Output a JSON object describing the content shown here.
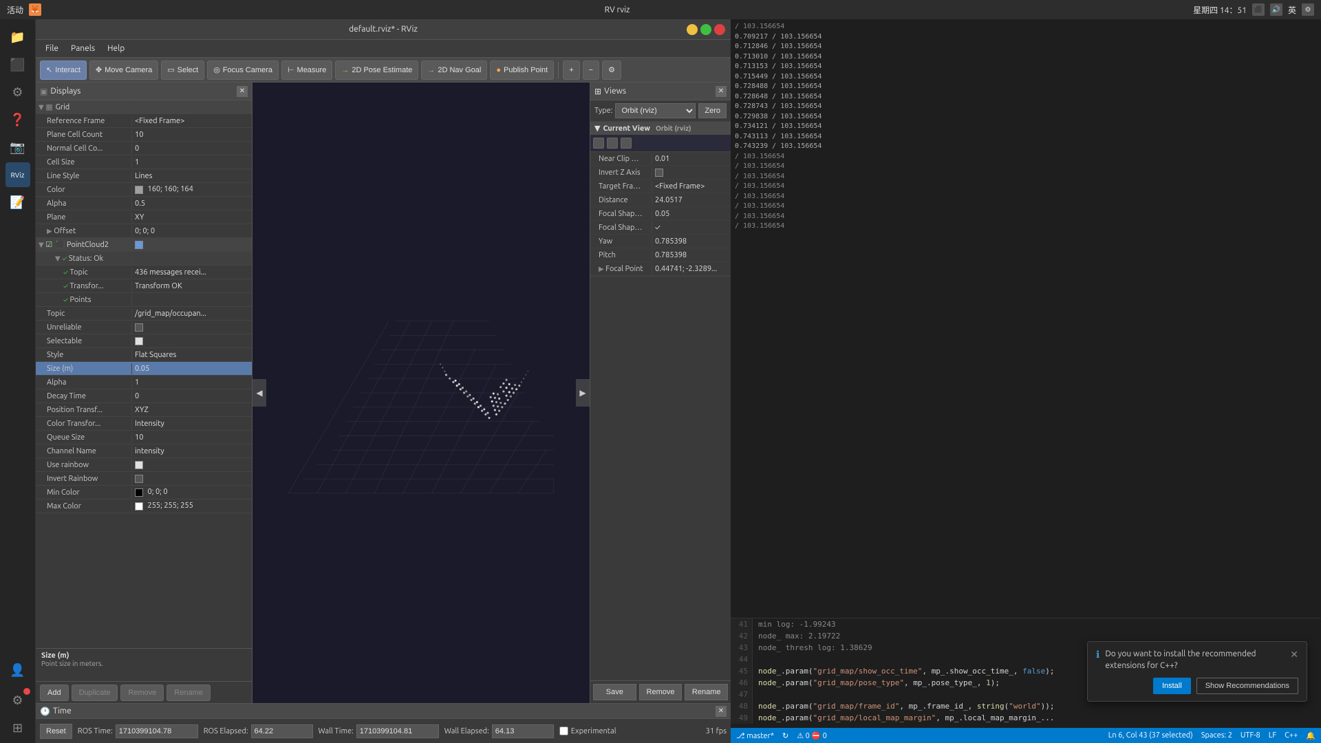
{
  "system_bar": {
    "app_name": "活动",
    "window_title": "RV rviz",
    "time": "星期四 14：51",
    "lang": "英"
  },
  "window": {
    "title": "default.rviz* - RViz"
  },
  "menu": {
    "file": "File",
    "panels": "Panels",
    "help": "Help"
  },
  "toolbar": {
    "interact": "Interact",
    "move_camera": "Move Camera",
    "select": "Select",
    "focus_camera": "Focus Camera",
    "measure": "Measure",
    "pose_estimate": "2D Pose Estimate",
    "nav_goal": "2D Nav Goal",
    "publish_point": "Publish Point"
  },
  "displays_panel": {
    "title": "Displays",
    "properties": [
      {
        "name": "Reference Frame",
        "value": "<Fixed Frame>",
        "indent": 1
      },
      {
        "name": "Plane Cell Count",
        "value": "10",
        "indent": 1
      },
      {
        "name": "Normal Cell Co...",
        "value": "0",
        "indent": 1
      },
      {
        "name": "Cell Size",
        "value": "1",
        "indent": 1
      },
      {
        "name": "Line Style",
        "value": "Lines",
        "indent": 1
      },
      {
        "name": "Color",
        "value": "160; 160; 164",
        "indent": 1,
        "has_swatch": true,
        "swatch_color": "#a0a0a4"
      },
      {
        "name": "Alpha",
        "value": "0.5",
        "indent": 1
      },
      {
        "name": "Plane",
        "value": "XY",
        "indent": 1
      },
      {
        "name": "Offset",
        "value": "0; 0; 0",
        "indent": 1,
        "has_arrow": true
      },
      {
        "name": "PointCloud2",
        "value": "",
        "indent": 0,
        "is_section": true,
        "checked": true
      },
      {
        "name": "Status: Ok",
        "value": "",
        "indent": 2,
        "has_check": true
      },
      {
        "name": "Topic",
        "value": "436 messages recei...",
        "indent": 3
      },
      {
        "name": "Transfor...",
        "value": "Transform OK",
        "indent": 3
      },
      {
        "name": "Points",
        "value": "",
        "indent": 3
      },
      {
        "name": "Topic",
        "value": "/grid_map/occupan...",
        "indent": 1
      },
      {
        "name": "Unreliable",
        "value": "",
        "indent": 1,
        "has_checkbox": true,
        "checked": false
      },
      {
        "name": "Selectable",
        "value": "",
        "indent": 1,
        "has_checkbox": true,
        "checked": true
      },
      {
        "name": "Style",
        "value": "Flat Squares",
        "indent": 1
      },
      {
        "name": "Size (m)",
        "value": "0.05",
        "indent": 1,
        "highlighted": true
      },
      {
        "name": "Alpha",
        "value": "1",
        "indent": 1
      },
      {
        "name": "Decay Time",
        "value": "0",
        "indent": 1
      },
      {
        "name": "Position Transf...",
        "value": "XYZ",
        "indent": 1
      },
      {
        "name": "Color Transfor...",
        "value": "Intensity",
        "indent": 1
      },
      {
        "name": "Queue Size",
        "value": "10",
        "indent": 1
      },
      {
        "name": "Channel Name",
        "value": "intensity",
        "indent": 1
      },
      {
        "name": "Use rainbow",
        "value": "",
        "indent": 1,
        "has_checkbox": true,
        "checked": true
      },
      {
        "name": "Invert Rainbow",
        "value": "",
        "indent": 1,
        "has_checkbox": true,
        "checked": false
      },
      {
        "name": "Min Color",
        "value": "0; 0; 0",
        "indent": 1,
        "has_swatch": true,
        "swatch_color": "#000000"
      },
      {
        "name": "Max Color",
        "value": "255; 255; 255",
        "indent": 1,
        "has_swatch": true,
        "swatch_color": "#ffffff"
      }
    ],
    "tooltip_title": "Size (m)",
    "tooltip_desc": "Point size in meters.",
    "buttons": [
      "Add",
      "Duplicate",
      "Remove",
      "Rename"
    ]
  },
  "views_panel": {
    "title": "Views",
    "type_label": "Type:",
    "type_value": "Orbit (rviz)",
    "zero_btn": "Zero",
    "current_view": {
      "title": "Current View",
      "type": "Orbit (rviz)",
      "properties": [
        {
          "name": "Near Clip …",
          "value": "0.01"
        },
        {
          "name": "Invert Z Axis",
          "value": "checkbox_empty"
        },
        {
          "name": "Target Fra…",
          "value": "<Fixed Frame>"
        },
        {
          "name": "Distance",
          "value": "24.0517"
        },
        {
          "name": "Focal Shap…",
          "value": "0.05"
        },
        {
          "name": "Focal Shap…",
          "value": "✓"
        },
        {
          "name": "Yaw",
          "value": "0.785398"
        },
        {
          "name": "Pitch",
          "value": "0.785398"
        },
        {
          "name": "Focal Point",
          "value": "0.44741; -2.3289...",
          "has_arrow": true
        }
      ]
    },
    "buttons": [
      "Save",
      "Remove",
      "Rename"
    ]
  },
  "time_panel": {
    "title": "Time",
    "ros_time_label": "ROS Time:",
    "ros_time_value": "1710399104.78",
    "ros_elapsed_label": "ROS Elapsed:",
    "ros_elapsed_value": "64.22",
    "wall_time_label": "Wall Time:",
    "wall_time_value": "1710399104.81",
    "wall_elapsed_label": "Wall Elapsed:",
    "wall_elapsed_value": "64.13",
    "experimental_label": "Experimental",
    "fps": "31 fps",
    "reset_btn": "Reset"
  },
  "log_terminal": {
    "lines": [
      "0.709217 / 103.156654",
      "0.712846 / 103.156654",
      "0.713010 / 103.156654",
      "0.713153 / 103.156654",
      "0.715449 / 103.156654",
      "0.728488 / 103.156654",
      "0.728648 / 103.156654",
      "0.728743 / 103.156654",
      "0.729838 / 103.156654",
      "0.734121 / 103.156654",
      "0.743113 / 103.156654",
      "0.743239 / 103.156654",
      "/ 103.156654",
      "/ 103.156654",
      "/ 103.156654",
      "/ 103.156654",
      "/ 103.156654",
      "/ 103.156654",
      "/ 103.156654",
      "/ 103.156654"
    ]
  },
  "code_editor": {
    "lines": [
      {
        "num": "41",
        "content": "    min log: -1.99243"
      },
      {
        "num": "42",
        "content": "node_    max: 2.19722"
      },
      {
        "num": "43",
        "content": "node_    thresh log: 1.38629"
      },
      {
        "num": "44",
        "content": ""
      },
      {
        "num": "45",
        "content": "  node_.param(\"grid_map/show_occ_time\", mp_.show_occ_time_, false);"
      },
      {
        "num": "46",
        "content": "  node_.param(\"grid_map/pose_type\", mp_.pose_type_, 1);"
      },
      {
        "num": "47",
        "content": ""
      },
      {
        "num": "48",
        "content": "  node_.param(\"grid_map/frame_id\", mp_.frame_id_, string(\"world\"));"
      },
      {
        "num": "49",
        "content": "  node_.param(\"grid_map/local_map_margin\", mp_.local_map_margin_..."
      }
    ]
  },
  "notification": {
    "text": "Do you want to install the recommended extensions for C++?",
    "install_btn": "Install",
    "show_btn": "Show Recommendations"
  },
  "status_bar": {
    "branch": "master*",
    "sync": "",
    "warnings": "0",
    "ln_col": "Ln 6, Col 43 (37 selected)",
    "spaces": "Spaces: 2",
    "encoding": "UTF-8",
    "lang": "LF",
    "cpp": "C++",
    "feedback": ""
  }
}
